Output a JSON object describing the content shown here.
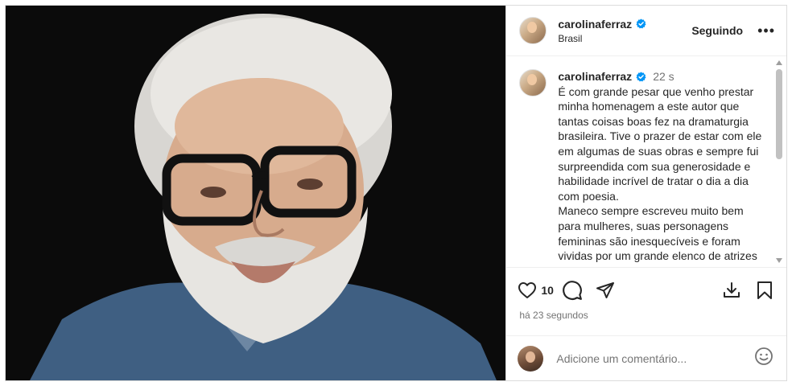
{
  "post": {
    "image_alt": "Retrato de homem de cabelos e barba brancos usando óculos pretos e camisa jeans",
    "header": {
      "username": "carolinaferraz",
      "location": "Brasil",
      "follow_status": "Seguindo",
      "more_label": "•••"
    },
    "caption": {
      "username": "carolinaferraz",
      "time_ago": "22 s",
      "text": "É com grande pesar que venho prestar minha homenagem a este autor que tantas coisas boas fez na dramaturgia brasileira. Tive o prazer de estar com ele em algumas de suas obras e sempre fui surpreendida com sua generosidade e habilidade incrível de tratar o dia a dia com poesia.\nManeco sempre escreveu muito bem para mulheres, suas personagens femininas são inesquecíveis e foram vividas por um grande elenco de atrizes talentosíssimas."
    },
    "actions": {
      "like_count": "10",
      "posted_ago": "há 23 segundos"
    },
    "comment": {
      "placeholder": "Adicione um comentário..."
    },
    "icons": [
      "verified-icon",
      "more-icon",
      "heart-icon",
      "comment-icon",
      "share-icon",
      "download-icon",
      "bookmark-icon",
      "emoji-icon"
    ],
    "colors": {
      "verified": "#0095f6",
      "text": "#262626",
      "muted": "#737373",
      "border": "#dbdbdb"
    }
  }
}
